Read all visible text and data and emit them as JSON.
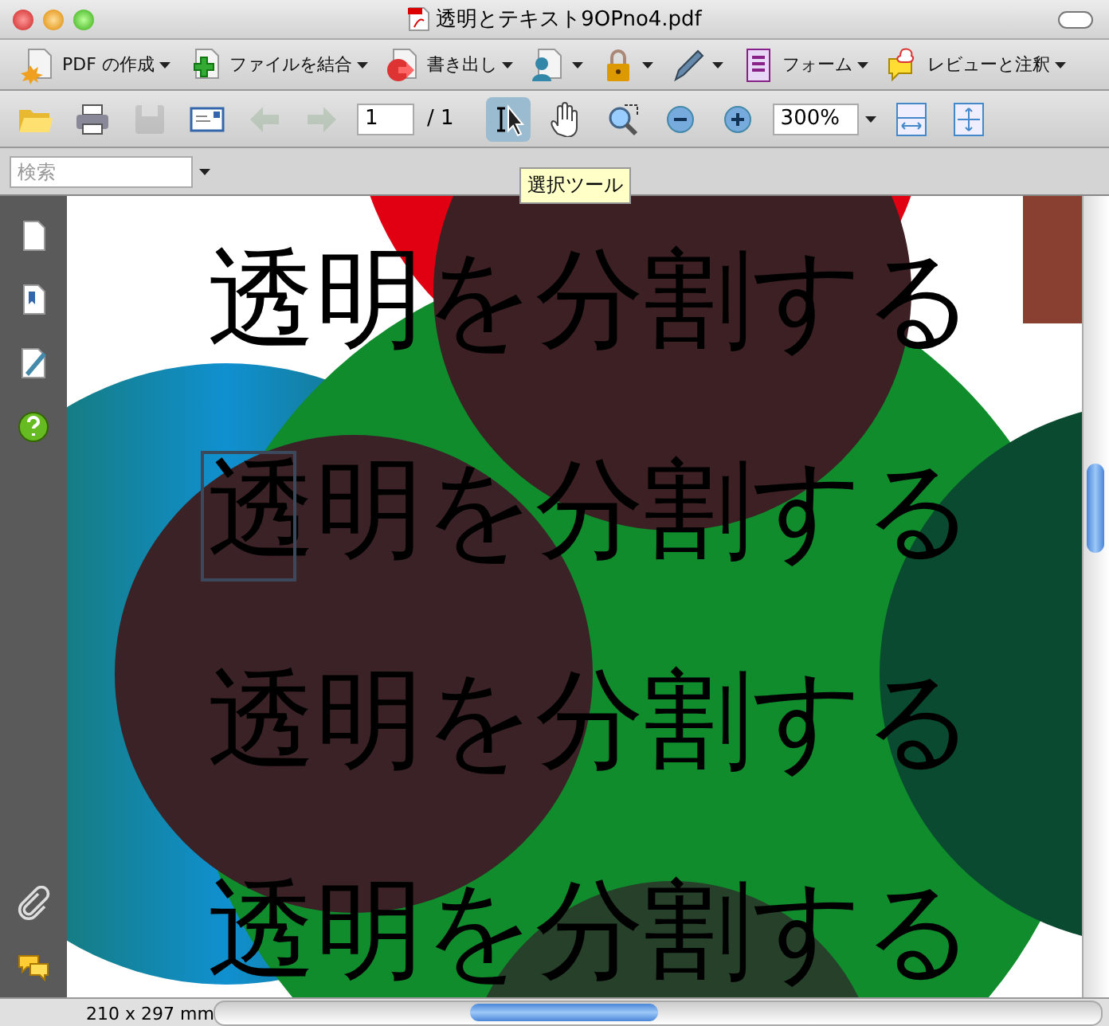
{
  "window": {
    "title": "透明とテキスト9OPno4.pdf"
  },
  "toolbar": [
    {
      "kind": "create",
      "label": "PDF の作成"
    },
    {
      "kind": "combine",
      "label": "ファイルを結合"
    },
    {
      "kind": "export",
      "label": "書き出し"
    },
    {
      "kind": "share"
    },
    {
      "kind": "lock"
    },
    {
      "kind": "pen"
    },
    {
      "kind": "form",
      "label": "フォーム"
    },
    {
      "kind": "review",
      "label": "レビューと注釈"
    }
  ],
  "tools": [
    {
      "kind": "open",
      "disabled": false,
      "selected": false
    },
    {
      "kind": "print",
      "disabled": false,
      "selected": false
    },
    {
      "kind": "save",
      "disabled": true,
      "selected": false
    },
    {
      "kind": "email",
      "disabled": false,
      "selected": false
    },
    {
      "kind": "prev",
      "disabled": true,
      "selected": false
    },
    {
      "kind": "next",
      "disabled": true,
      "selected": false
    },
    {
      "kind": "page",
      "value": "1",
      "total": "/ 1"
    },
    {
      "kind": "select",
      "disabled": false,
      "selected": true
    },
    {
      "kind": "hand",
      "disabled": false,
      "selected": false
    },
    {
      "kind": "marquee",
      "disabled": false,
      "selected": false
    },
    {
      "kind": "zoomout",
      "disabled": false,
      "selected": false
    },
    {
      "kind": "zoomin",
      "disabled": false,
      "selected": false
    },
    {
      "kind": "zoom",
      "value": "300%"
    },
    {
      "kind": "fitwidth",
      "disabled": false,
      "selected": false
    },
    {
      "kind": "fitpage",
      "disabled": false,
      "selected": false
    }
  ],
  "search": {
    "placeholder": "検索"
  },
  "tooltip": "選択ツール",
  "sidebar": [
    {
      "kind": "pages"
    },
    {
      "kind": "bookmarks"
    },
    {
      "kind": "signatures"
    },
    {
      "kind": "help"
    }
  ],
  "sidebar_bottom": [
    {
      "kind": "attachments"
    },
    {
      "kind": "comments"
    }
  ],
  "document": {
    "rows": [
      {
        "text": "透明を分割する",
        "highlighted": false
      },
      {
        "text": "透明を分割する",
        "highlighted": true
      },
      {
        "text": "透明を分割する",
        "highlighted": false
      },
      {
        "text": "透明を分割する",
        "highlighted": false
      }
    ]
  },
  "status_bar": {
    "page_size": "210 x 297 mm"
  }
}
